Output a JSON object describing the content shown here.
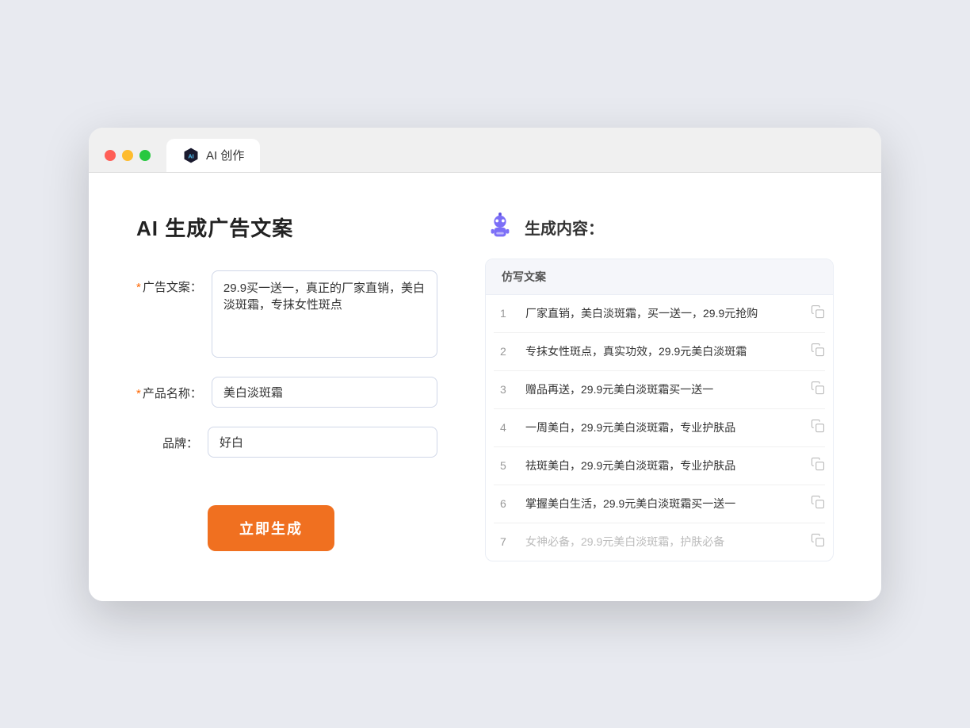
{
  "browser": {
    "tab_icon_alt": "AI icon",
    "tab_label": "AI 创作"
  },
  "left": {
    "title": "AI 生成广告文案",
    "fields": [
      {
        "label": "广告文案：",
        "required": true,
        "type": "textarea",
        "value": "29.9买一送一，真正的厂家直销，美白淡斑霜，专抹女性斑点",
        "placeholder": ""
      },
      {
        "label": "产品名称：",
        "required": true,
        "type": "input",
        "value": "美白淡斑霜",
        "placeholder": ""
      },
      {
        "label": "品牌：",
        "required": false,
        "type": "input",
        "value": "好白",
        "placeholder": ""
      }
    ],
    "button_label": "立即生成"
  },
  "right": {
    "title": "生成内容：",
    "table_header": "仿写文案",
    "rows": [
      {
        "num": "1",
        "text": "厂家直销，美白淡斑霜，买一送一，29.9元抢购",
        "muted": false
      },
      {
        "num": "2",
        "text": "专抹女性斑点，真实功效，29.9元美白淡斑霜",
        "muted": false
      },
      {
        "num": "3",
        "text": "赠品再送，29.9元美白淡斑霜买一送一",
        "muted": false
      },
      {
        "num": "4",
        "text": "一周美白，29.9元美白淡斑霜，专业护肤品",
        "muted": false
      },
      {
        "num": "5",
        "text": "祛斑美白，29.9元美白淡斑霜，专业护肤品",
        "muted": false
      },
      {
        "num": "6",
        "text": "掌握美白生活，29.9元美白淡斑霜买一送一",
        "muted": false
      },
      {
        "num": "7",
        "text": "女神必备，29.9元美白淡斑霜，护肤必备",
        "muted": true
      }
    ]
  }
}
